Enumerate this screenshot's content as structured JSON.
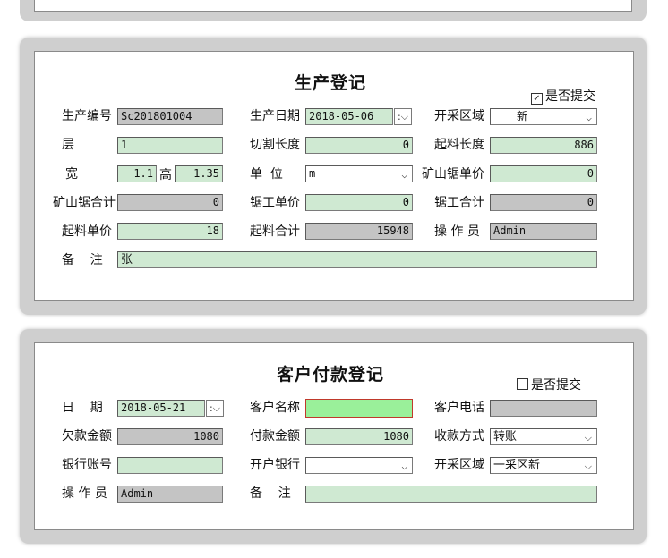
{
  "production": {
    "title": "生产登记",
    "submitted_label": "是否提交",
    "submitted_checked": true,
    "fields": {
      "prod_no": {
        "label": "生产编号",
        "value": "Sc201801004"
      },
      "prod_date": {
        "label": "生产日期",
        "value": "2018-05-06"
      },
      "area": {
        "label": "开采区域",
        "value": "新"
      },
      "layer": {
        "label": "层",
        "value": "1"
      },
      "cut_length": {
        "label": "切割长度",
        "value": "0"
      },
      "lift_length": {
        "label": "起料长度",
        "value": "886"
      },
      "width": {
        "label": "宽",
        "value": "1.1"
      },
      "height": {
        "label": "高",
        "value": "1.35"
      },
      "unit": {
        "label": "单  位",
        "value": "m"
      },
      "mine_saw_price": {
        "label": "矿山锯单价",
        "value": "0"
      },
      "mine_saw_total": {
        "label": "矿山锯合计",
        "value": "0"
      },
      "saw_price": {
        "label": "锯工单价",
        "value": "0"
      },
      "saw_total": {
        "label": "锯工合计",
        "value": "0"
      },
      "lift_price": {
        "label": "起料单价",
        "value": "18"
      },
      "lift_total": {
        "label": "起料合计",
        "value": "15948"
      },
      "operator": {
        "label": "操 作 员",
        "value": "Admin"
      },
      "remark": {
        "label": "备    注",
        "value": "张"
      }
    }
  },
  "payment": {
    "title": "客户付款登记",
    "submitted_label": "是否提交",
    "submitted_checked": false,
    "fields": {
      "date": {
        "label": "日    期",
        "value": "2018-05-21"
      },
      "customer_name": {
        "label": "客户名称",
        "value": ""
      },
      "customer_phone": {
        "label": "客户电话",
        "value": ""
      },
      "owed": {
        "label": "欠款金额",
        "value": "1080"
      },
      "paid": {
        "label": "付款金额",
        "value": "1080"
      },
      "method": {
        "label": "收款方式",
        "value": "转账"
      },
      "account": {
        "label": "银行账号",
        "value": ""
      },
      "bank": {
        "label": "开户银行",
        "value": ""
      },
      "area": {
        "label": "开采区域",
        "value": "一采区新"
      },
      "operator": {
        "label": "操 作 员",
        "value": "Admin"
      },
      "remark": {
        "label": "备    注",
        "value": ""
      }
    }
  }
}
